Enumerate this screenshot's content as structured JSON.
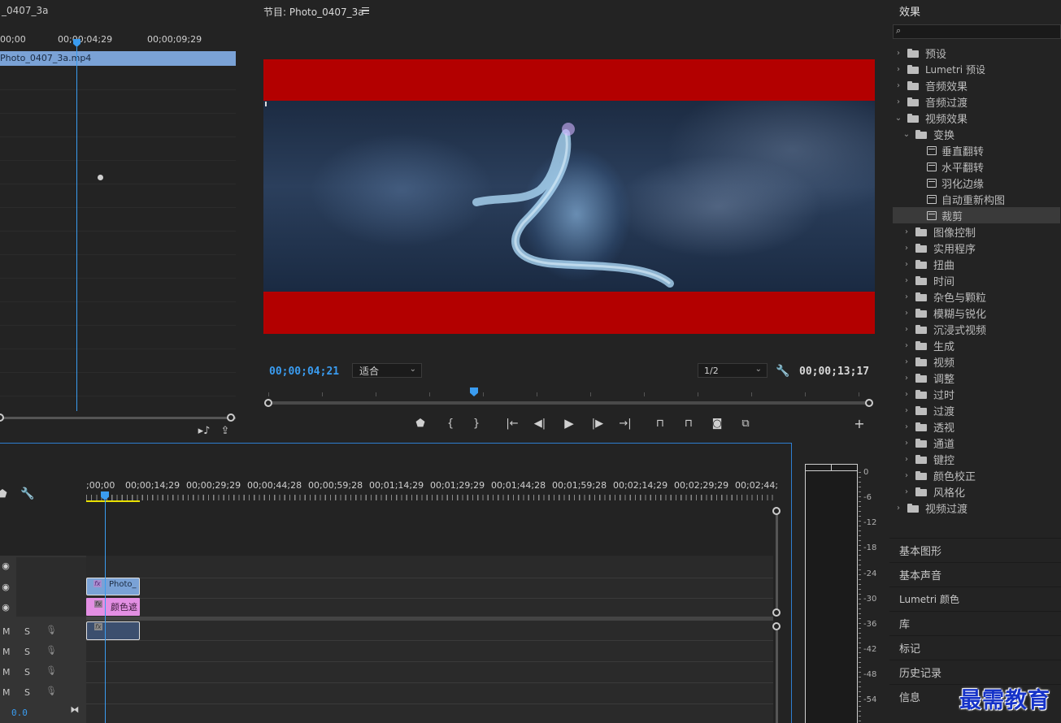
{
  "source_monitor": {
    "title": "_0407_3a",
    "ruler_labels": [
      "00;00",
      "00;00;04;29",
      "00;00;09;29"
    ],
    "clip_name": "Photo_0407_3a.mp4"
  },
  "program_monitor": {
    "title": "节目: Photo_0407_3a",
    "menu_icon": "hamburger-icon",
    "timecode_current": "00;00;04;21",
    "fit_value": "适合",
    "resolution_value": "1/2",
    "timecode_duration": "00;00;13;17",
    "letterbox_color": "#b30000"
  },
  "timeline": {
    "ruler_labels": [
      ";00;00",
      "00;00;14;29",
      "00;00;29;29",
      "00;00;44;28",
      "00;00;59;28",
      "00;01;14;29",
      "00;01;29;29",
      "00;01;44;28",
      "00;01;59;28",
      "00;02;14;29",
      "00;02;29;29",
      "00;02;44;"
    ],
    "clips": {
      "v3_label": "Photo_",
      "v2_label": "颜色遮",
      "fx_label": "fx"
    },
    "track_buttons": {
      "mute": "M",
      "solo": "S"
    },
    "volume_value": "0.0"
  },
  "effects_panel": {
    "title": "效果",
    "search_placeholder": "",
    "items": [
      {
        "label": "预设",
        "level": 0,
        "arrow": "›",
        "type": "folder-star"
      },
      {
        "label": "Lumetri 预设",
        "level": 0,
        "arrow": "›",
        "type": "folder-star"
      },
      {
        "label": "音频效果",
        "level": 0,
        "arrow": "›",
        "type": "folder"
      },
      {
        "label": "音频过渡",
        "level": 0,
        "arrow": "›",
        "type": "folder"
      },
      {
        "label": "视频效果",
        "level": 0,
        "arrow": "⌄",
        "type": "folder"
      },
      {
        "label": "变换",
        "level": 1,
        "arrow": "⌄",
        "type": "folder"
      },
      {
        "label": "垂直翻转",
        "level": 2,
        "arrow": "",
        "type": "effect"
      },
      {
        "label": "水平翻转",
        "level": 2,
        "arrow": "",
        "type": "effect"
      },
      {
        "label": "羽化边缘",
        "level": 2,
        "arrow": "",
        "type": "effect"
      },
      {
        "label": "自动重新构图",
        "level": 2,
        "arrow": "",
        "type": "effect"
      },
      {
        "label": "裁剪",
        "level": 2,
        "arrow": "",
        "type": "effect",
        "selected": true
      },
      {
        "label": "图像控制",
        "level": 1,
        "arrow": "›",
        "type": "folder"
      },
      {
        "label": "实用程序",
        "level": 1,
        "arrow": "›",
        "type": "folder"
      },
      {
        "label": "扭曲",
        "level": 1,
        "arrow": "›",
        "type": "folder"
      },
      {
        "label": "时间",
        "level": 1,
        "arrow": "›",
        "type": "folder"
      },
      {
        "label": "杂色与颗粒",
        "level": 1,
        "arrow": "›",
        "type": "folder"
      },
      {
        "label": "模糊与锐化",
        "level": 1,
        "arrow": "›",
        "type": "folder"
      },
      {
        "label": "沉浸式视频",
        "level": 1,
        "arrow": "›",
        "type": "folder"
      },
      {
        "label": "生成",
        "level": 1,
        "arrow": "›",
        "type": "folder"
      },
      {
        "label": "视频",
        "level": 1,
        "arrow": "›",
        "type": "folder"
      },
      {
        "label": "调整",
        "level": 1,
        "arrow": "›",
        "type": "folder"
      },
      {
        "label": "过时",
        "level": 1,
        "arrow": "›",
        "type": "folder"
      },
      {
        "label": "过渡",
        "level": 1,
        "arrow": "›",
        "type": "folder"
      },
      {
        "label": "透视",
        "level": 1,
        "arrow": "›",
        "type": "folder"
      },
      {
        "label": "通道",
        "level": 1,
        "arrow": "›",
        "type": "folder"
      },
      {
        "label": "键控",
        "level": 1,
        "arrow": "›",
        "type": "folder"
      },
      {
        "label": "颜色校正",
        "level": 1,
        "arrow": "›",
        "type": "folder"
      },
      {
        "label": "风格化",
        "level": 1,
        "arrow": "›",
        "type": "folder"
      },
      {
        "label": "视频过渡",
        "level": 0,
        "arrow": "›",
        "type": "folder"
      }
    ]
  },
  "side_tabs": [
    "基本图形",
    "基本声音",
    "Lumetri 颜色",
    "库",
    "标记",
    "历史记录",
    "信息"
  ],
  "vu_meter": {
    "labels": [
      "0",
      "-6",
      "-12",
      "-18",
      "-24",
      "-30",
      "-36",
      "-42",
      "-48",
      "-54"
    ]
  },
  "watermark": "最需教育",
  "colors": {
    "accent_blue": "#3a9cf0",
    "clip_blue": "#7aa2d6",
    "clip_pink": "#e38fe3",
    "selection_yellow": "#e8e000"
  }
}
